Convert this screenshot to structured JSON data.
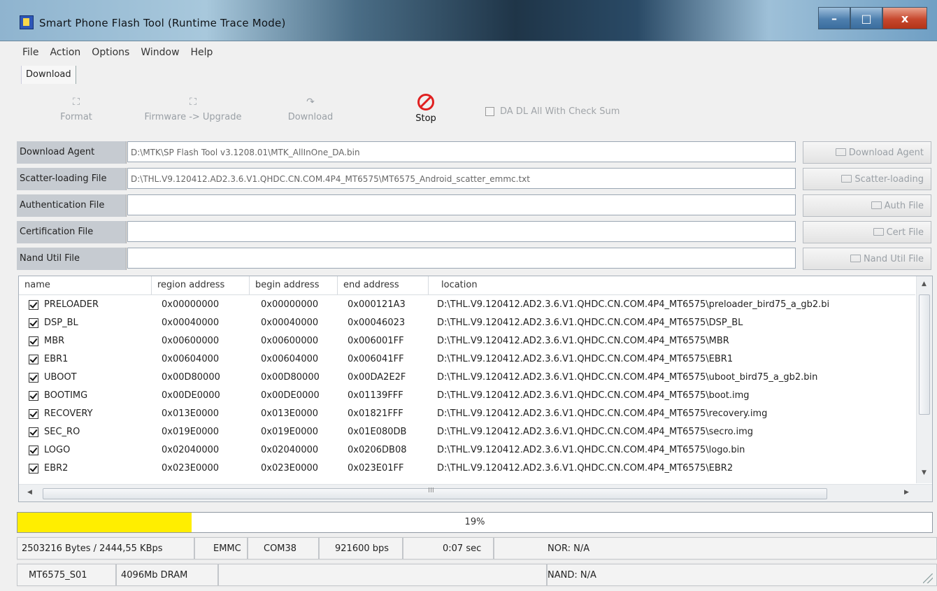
{
  "window": {
    "title": "Smart Phone Flash Tool (Runtime Trace Mode)",
    "controls": {
      "minimize": "–",
      "maximize": "□",
      "close": "x"
    }
  },
  "menu": [
    "File",
    "Action",
    "Options",
    "Window",
    "Help"
  ],
  "tab": "Download",
  "toolbar": {
    "format": "Format",
    "firmware_upgrade": "Firmware -> Upgrade",
    "download": "Download",
    "stop": "Stop",
    "checksum_label": "DA DL All With Check Sum"
  },
  "files": [
    {
      "label": "Download Agent",
      "value": "D:\\MTK\\SP Flash Tool v3.1208.01\\MTK_AllInOne_DA.bin",
      "button": "Download Agent"
    },
    {
      "label": "Scatter-loading File",
      "value": "D:\\THL.V9.120412.AD2.3.6.V1.QHDC.CN.COM.4P4_MT6575\\MT6575_Android_scatter_emmc.txt",
      "button": "Scatter-loading"
    },
    {
      "label": "Authentication File",
      "value": "",
      "button": "Auth File"
    },
    {
      "label": "Certification File",
      "value": "",
      "button": "Cert File"
    },
    {
      "label": "Nand Util File",
      "value": "",
      "button": "Nand Util File"
    }
  ],
  "table": {
    "columns": [
      "name",
      "region address",
      "begin address",
      "end address",
      "location"
    ],
    "rows": [
      {
        "name": "PRELOADER",
        "region": "0x00000000",
        "begin": "0x00000000",
        "end": "0x000121A3",
        "location": "D:\\THL.V9.120412.AD2.3.6.V1.QHDC.CN.COM.4P4_MT6575\\preloader_bird75_a_gb2.bi"
      },
      {
        "name": "DSP_BL",
        "region": "0x00040000",
        "begin": "0x00040000",
        "end": "0x00046023",
        "location": "D:\\THL.V9.120412.AD2.3.6.V1.QHDC.CN.COM.4P4_MT6575\\DSP_BL"
      },
      {
        "name": "MBR",
        "region": "0x00600000",
        "begin": "0x00600000",
        "end": "0x006001FF",
        "location": "D:\\THL.V9.120412.AD2.3.6.V1.QHDC.CN.COM.4P4_MT6575\\MBR"
      },
      {
        "name": "EBR1",
        "region": "0x00604000",
        "begin": "0x00604000",
        "end": "0x006041FF",
        "location": "D:\\THL.V9.120412.AD2.3.6.V1.QHDC.CN.COM.4P4_MT6575\\EBR1"
      },
      {
        "name": "UBOOT",
        "region": "0x00D80000",
        "begin": "0x00D80000",
        "end": "0x00DA2E2F",
        "location": "D:\\THL.V9.120412.AD2.3.6.V1.QHDC.CN.COM.4P4_MT6575\\uboot_bird75_a_gb2.bin"
      },
      {
        "name": "BOOTIMG",
        "region": "0x00DE0000",
        "begin": "0x00DE0000",
        "end": "0x01139FFF",
        "location": "D:\\THL.V9.120412.AD2.3.6.V1.QHDC.CN.COM.4P4_MT6575\\boot.img"
      },
      {
        "name": "RECOVERY",
        "region": "0x013E0000",
        "begin": "0x013E0000",
        "end": "0x01821FFF",
        "location": "D:\\THL.V9.120412.AD2.3.6.V1.QHDC.CN.COM.4P4_MT6575\\recovery.img"
      },
      {
        "name": "SEC_RO",
        "region": "0x019E0000",
        "begin": "0x019E0000",
        "end": "0x01E080DB",
        "location": "D:\\THL.V9.120412.AD2.3.6.V1.QHDC.CN.COM.4P4_MT6575\\secro.img"
      },
      {
        "name": "LOGO",
        "region": "0x02040000",
        "begin": "0x02040000",
        "end": "0x0206DB08",
        "location": "D:\\THL.V9.120412.AD2.3.6.V1.QHDC.CN.COM.4P4_MT6575\\logo.bin"
      },
      {
        "name": "EBR2",
        "region": "0x023E0000",
        "begin": "0x023E0000",
        "end": "0x023E01FF",
        "location": "D:\\THL.V9.120412.AD2.3.6.V1.QHDC.CN.COM.4P4_MT6575\\EBR2"
      }
    ],
    "hscroll_label": "III"
  },
  "progress": {
    "percent": 19,
    "label": "19%",
    "color": "#ffee00"
  },
  "status1": {
    "bytes": "2503216 Bytes / 2444,55 KBps",
    "storage": "EMMC",
    "port": "COM38",
    "baud": "921600 bps",
    "time": "0:07 sec",
    "nor": "NOR: N/A"
  },
  "status2": {
    "chip": "MT6575_S01",
    "dram": "4096Mb DRAM",
    "nand": "NAND: N/A"
  }
}
